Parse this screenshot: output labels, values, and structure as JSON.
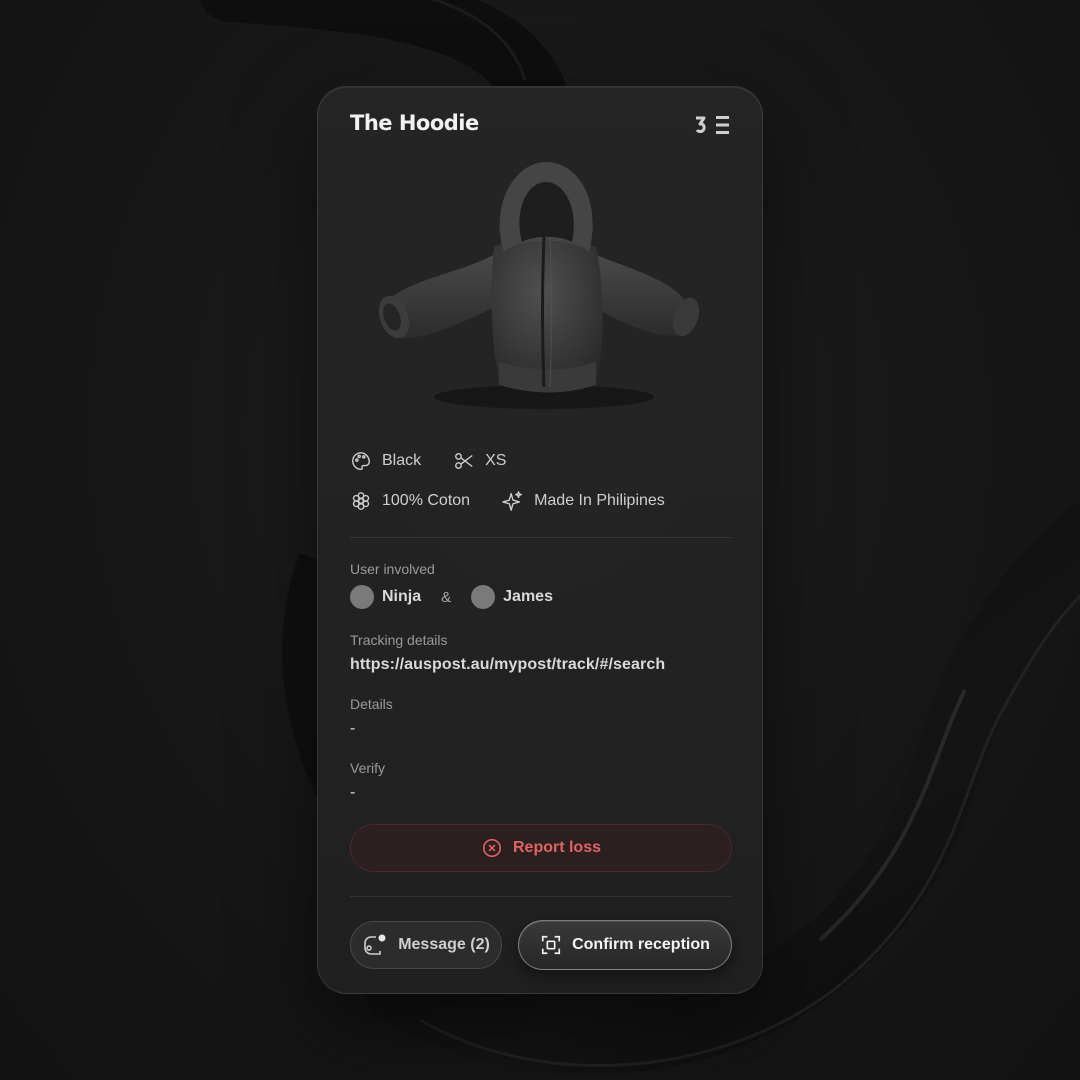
{
  "product": {
    "title": "The Hoodie",
    "brand_logo_icon": "brand-logo-icon",
    "image_icon": "hoodie-3d-icon"
  },
  "attributes": [
    {
      "icon": "palette-icon",
      "label": "Black"
    },
    {
      "icon": "scissors-icon",
      "label": "XS"
    },
    {
      "icon": "flower-icon",
      "label": "100% Coton"
    },
    {
      "icon": "sparkles-icon",
      "label": "Made In Philipines"
    }
  ],
  "users_involved": {
    "label": "User involved",
    "users": [
      "Ninja",
      "James"
    ],
    "separator": "&"
  },
  "tracking": {
    "label": "Tracking details",
    "value": "https://auspost.au/mypost/track/#/search"
  },
  "details": {
    "label": "Details",
    "value": "-"
  },
  "verify": {
    "label": "Verify",
    "value": "-"
  },
  "actions": {
    "report_loss": "Report loss",
    "message": "Message (2)",
    "confirm": "Confirm reception"
  },
  "colors": {
    "card_bg": "#242424",
    "danger": "#e06464",
    "danger_bg": "#2b1f1f",
    "text": "#d9d9d9",
    "muted": "#9a9a9a"
  }
}
